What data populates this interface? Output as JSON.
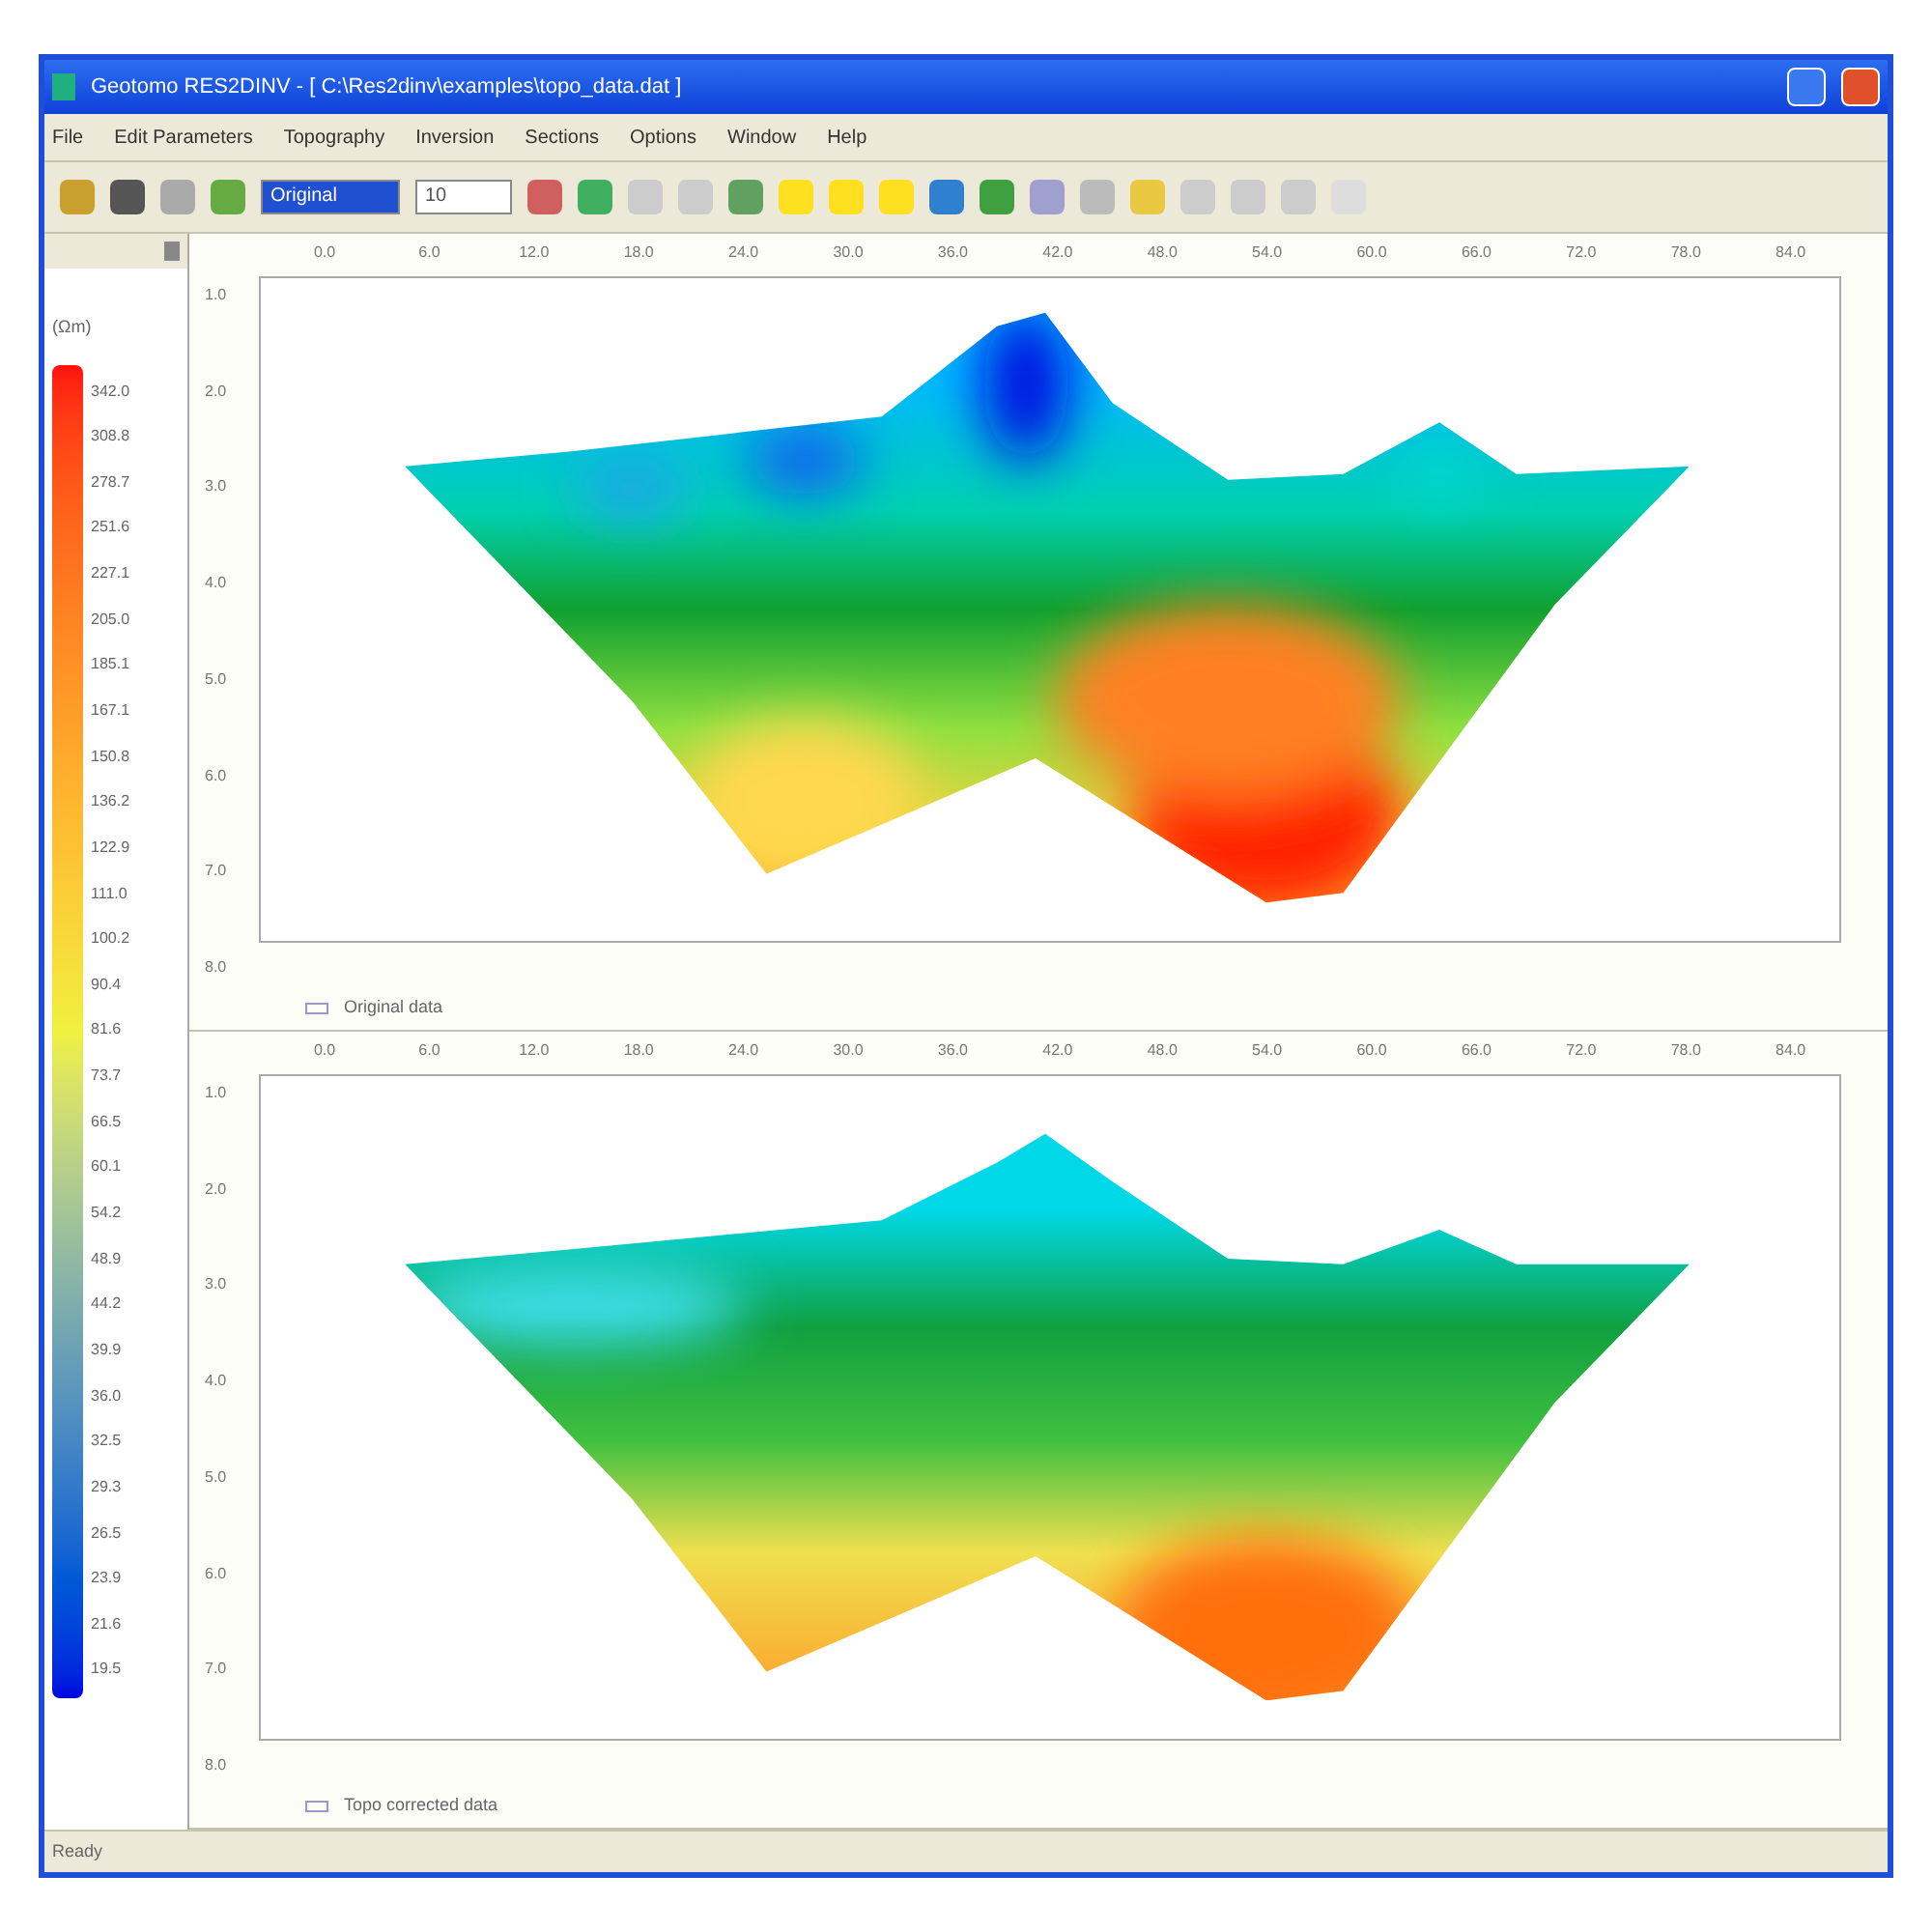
{
  "window": {
    "title": "Geotomo RES2DINV - [ C:\\Res2dinv\\examples\\topo_data.dat ]"
  },
  "menu": [
    "File",
    "Edit Parameters",
    "Topography",
    "Inversion",
    "Sections",
    "Options",
    "Window",
    "Help"
  ],
  "toolbar": {
    "combo_1": "Original",
    "combo_2": "10"
  },
  "legend": {
    "unit": "(Ωm)",
    "labels": [
      "342.0",
      "308.8",
      "278.7",
      "251.6",
      "227.1",
      "205.0",
      "185.1",
      "167.1",
      "150.8",
      "136.2",
      "122.9",
      "111.0",
      "100.2",
      "90.4",
      "81.6",
      "73.7",
      "66.5",
      "60.1",
      "54.2",
      "48.9",
      "44.2",
      "39.9",
      "36.0",
      "32.5",
      "29.3",
      "26.5",
      "23.9",
      "21.6",
      "19.5"
    ]
  },
  "sections": [
    {
      "caption": "Original data",
      "x_ticks": [
        "0.0",
        "6.0",
        "12.0",
        "18.0",
        "24.0",
        "30.0",
        "36.0",
        "42.0",
        "48.0",
        "54.0",
        "60.0",
        "66.0",
        "72.0",
        "78.0",
        "84.0"
      ],
      "y_ticks": [
        "1.0",
        "2.0",
        "3.0",
        "4.0",
        "5.0",
        "6.0",
        "7.0",
        "8.0"
      ],
      "kind": "original"
    },
    {
      "caption": "Topo corrected data",
      "x_ticks": [
        "0.0",
        "6.0",
        "12.0",
        "18.0",
        "24.0",
        "30.0",
        "36.0",
        "42.0",
        "48.0",
        "54.0",
        "60.0",
        "66.0",
        "72.0",
        "78.0",
        "84.0"
      ],
      "y_ticks": [
        "1.0",
        "2.0",
        "3.0",
        "4.0",
        "5.0",
        "6.0",
        "7.0",
        "8.0"
      ],
      "kind": "corrected"
    }
  ],
  "status_bar": "Ready"
}
